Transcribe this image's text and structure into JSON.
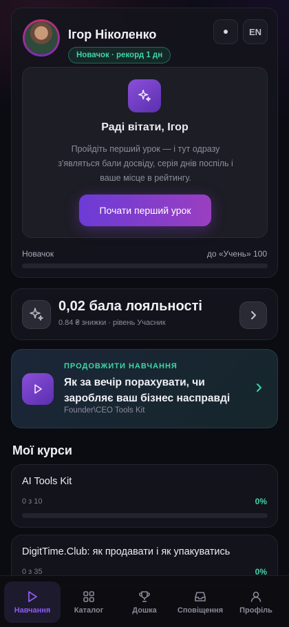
{
  "profile": {
    "name": "Ігор Ніколенко",
    "rank_badge": "Новачок · рекорд 1 дн",
    "theme_toggle_icon": "dot-icon",
    "language_button": "EN"
  },
  "welcome": {
    "title": "Раді вітати, Ігор",
    "text": "Пройдіть перший урок — і тут одразу з'являться бали досвіду, серія днів поспіль і ваше місце в рейтингу.",
    "button": "Почати перший урок"
  },
  "level": {
    "current": "Новачок",
    "next": "до «Учень» 100",
    "progress": 0
  },
  "loyalty": {
    "title": "0,02 бала лояльності",
    "subtitle": "0.84 ₴ знижки · рівень Учасник"
  },
  "continue": {
    "label": "ПРОДОВЖИТИ НАВЧАННЯ",
    "title": "Як за вечір порахувати, чи заробляє ваш бізнес насправді",
    "course": "Founder\\CEO Tools Kit"
  },
  "my_courses": {
    "title": "Мої курси",
    "items": [
      {
        "name": "AI Tools Kit",
        "count": "0 з 10",
        "percent": "0%",
        "progress": 0
      },
      {
        "name": "DigitTime.Club: як продавати і як упакуватись",
        "count": "0 з 35",
        "percent": "0%",
        "progress": 0
      }
    ]
  },
  "nav": {
    "items": [
      {
        "label": "Навчання",
        "icon": "play-icon",
        "active": true
      },
      {
        "label": "Каталог",
        "icon": "grid-icon"
      },
      {
        "label": "Дошка",
        "icon": "trophy-icon"
      },
      {
        "label": "Сповіщення",
        "icon": "inbox-icon"
      },
      {
        "label": "Профіль",
        "icon": "user-icon"
      }
    ]
  },
  "colors": {
    "accent": "#6c3bd6",
    "success": "#3fd6a6",
    "background": "#0b0b12"
  }
}
